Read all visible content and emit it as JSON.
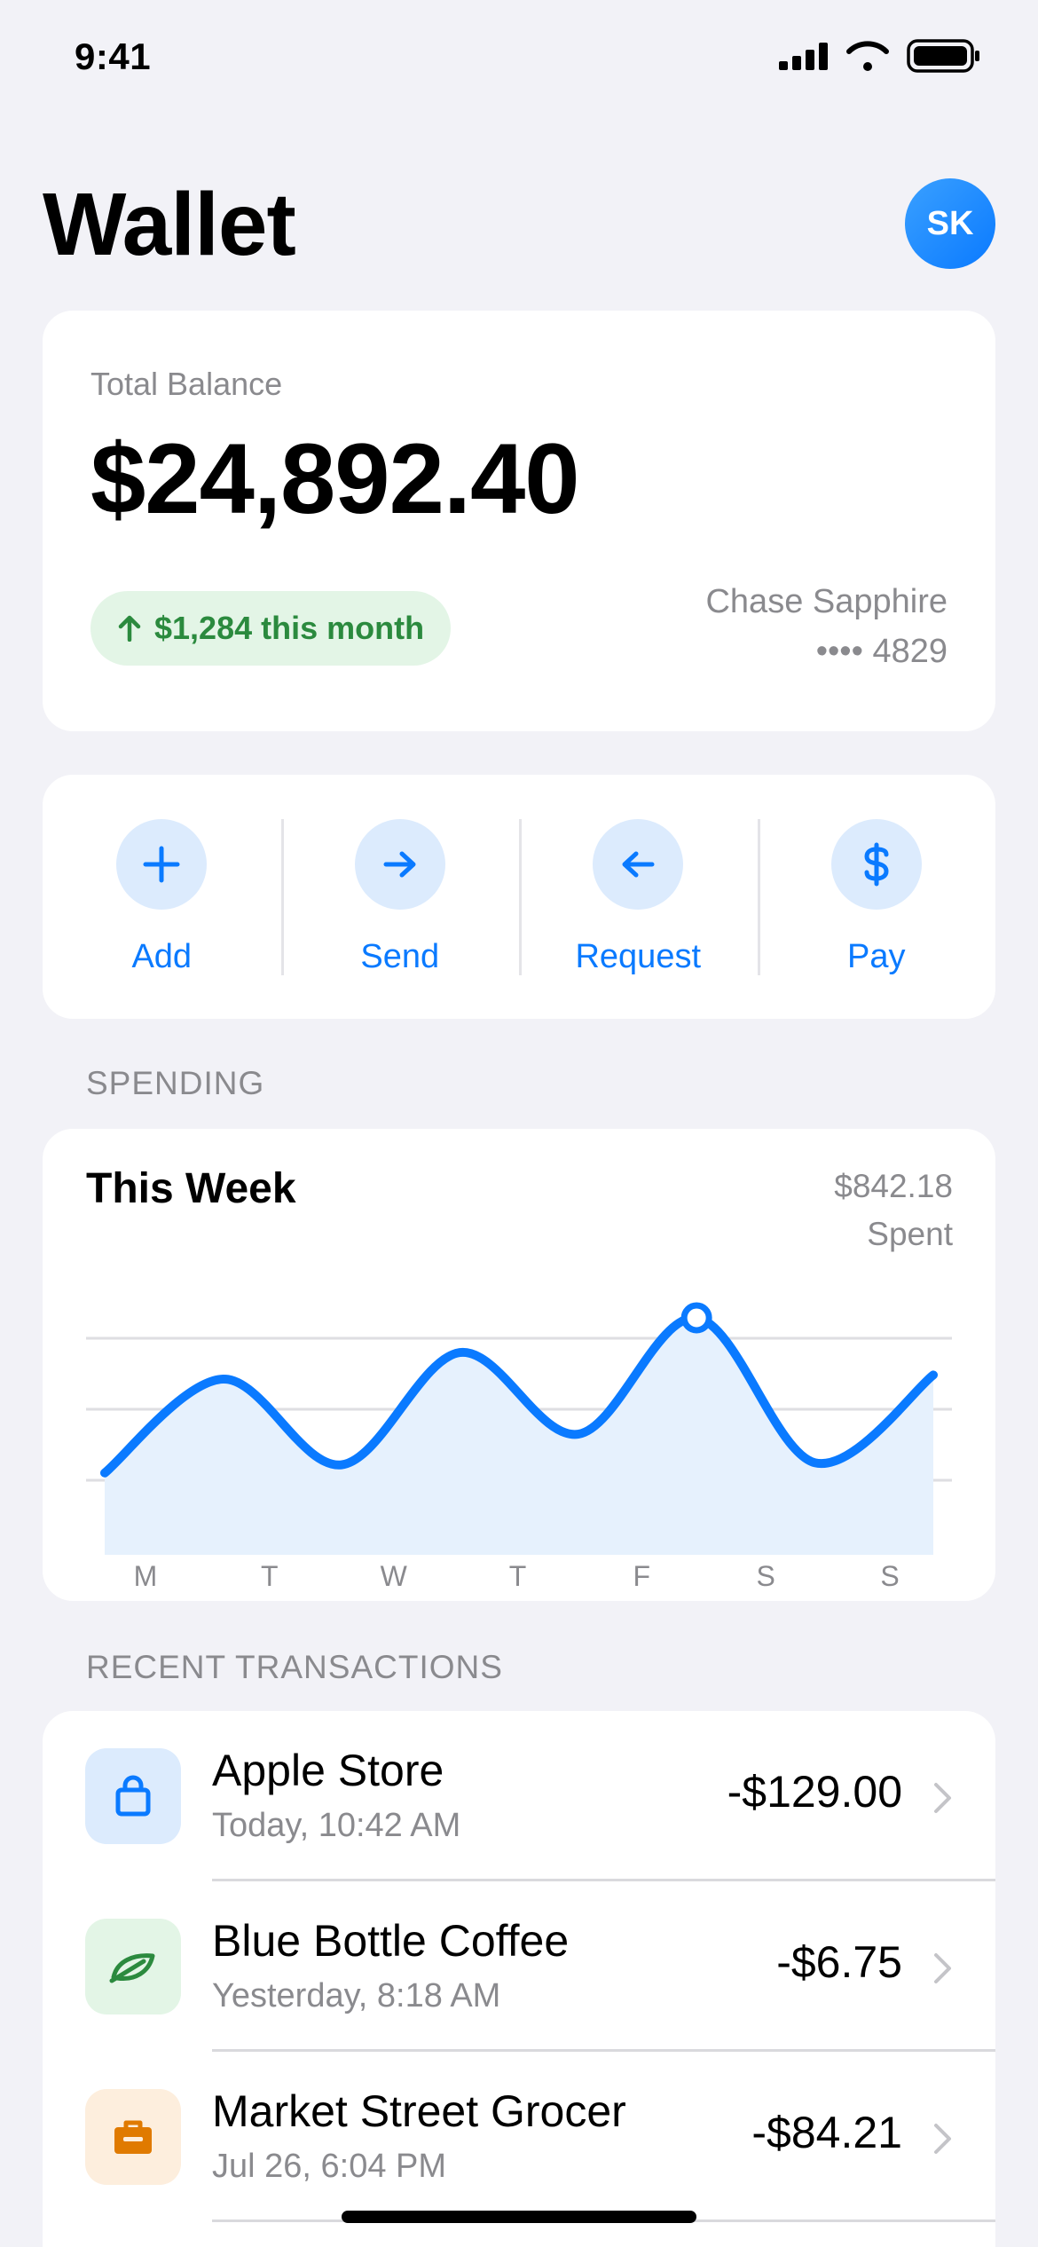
{
  "status_bar": {
    "time": "9:41"
  },
  "header": {
    "title": "Wallet",
    "avatar_initials": "SK"
  },
  "balance": {
    "label": "Total Balance",
    "amount": "$24,892.40",
    "change": "$1,284 this month",
    "card_name": "Chase Sapphire",
    "card_number": "•••• 4829"
  },
  "actions": [
    {
      "label": "Add",
      "icon": "plus-icon"
    },
    {
      "label": "Send",
      "icon": "arrow-right-icon"
    },
    {
      "label": "Request",
      "icon": "arrow-left-icon"
    },
    {
      "label": "Pay",
      "icon": "dollar-icon"
    }
  ],
  "spending": {
    "section_label": "SPENDING",
    "title": "This Week",
    "spent_amount": "$842.18",
    "spent_label": "Spent"
  },
  "chart_data": {
    "type": "area",
    "categories": [
      "M",
      "T",
      "W",
      "T",
      "F",
      "S",
      "S"
    ],
    "values": [
      0.14,
      0.6,
      0.18,
      0.73,
      0.33,
      0.9,
      0.19,
      0.62
    ],
    "highlight_index": 5,
    "line_color": "#0a7aff",
    "fill_color": "#e6f1fd",
    "grid": true
  },
  "transactions": {
    "section_label": "RECENT TRANSACTIONS",
    "items": [
      {
        "name": "Apple Store",
        "meta": "Today, 10:42 AM",
        "amount": "-$129.00",
        "icon": "shopping-bag-icon",
        "icon_bg": "#dcebfd",
        "icon_color": "#0a7aff"
      },
      {
        "name": "Blue Bottle Coffee",
        "meta": "Yesterday, 8:18 AM",
        "amount": "-$6.75",
        "icon": "leaf-icon",
        "icon_bg": "#e3f5e6",
        "icon_color": "#2b8a3e"
      },
      {
        "name": "Market Street Grocer",
        "meta": "Jul 26, 6:04 PM",
        "amount": "-$84.21",
        "icon": "briefcase-icon",
        "icon_bg": "#fdeedd",
        "icon_color": "#e07a00"
      }
    ]
  }
}
